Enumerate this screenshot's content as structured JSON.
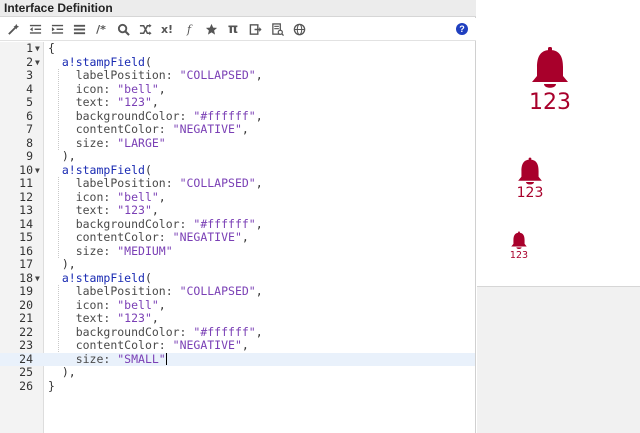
{
  "panel": {
    "title": "Interface Definition"
  },
  "toolbar": {
    "icons": [
      "magic-wand-icon",
      "outdent-icon",
      "indent-icon",
      "list-icon",
      "comment-icon",
      "search-icon",
      "shuffle-icon",
      "expression-icon",
      "star-icon",
      "pi-icon",
      "export-icon",
      "database-icon",
      "globe-icon"
    ],
    "labels": {
      "comment": "/*",
      "expression": "x!",
      "fx": "𝑓",
      "pi": "π"
    },
    "help": "?"
  },
  "code": {
    "line_numbers": [
      "1",
      "2",
      "3",
      "4",
      "5",
      "6",
      "7",
      "8",
      "9",
      "10",
      "11",
      "12",
      "13",
      "14",
      "15",
      "16",
      "17",
      "18",
      "19",
      "20",
      "21",
      "22",
      "23",
      "24",
      "25",
      "26"
    ],
    "stamps": [
      {
        "labelPosition": "\"COLLAPSED\"",
        "icon": "\"bell\"",
        "text": "\"123\"",
        "backgroundColor": "\"#ffffff\"",
        "contentColor": "\"NEGATIVE\"",
        "size": "\"LARGE\""
      },
      {
        "labelPosition": "\"COLLAPSED\"",
        "icon": "\"bell\"",
        "text": "\"123\"",
        "backgroundColor": "\"#ffffff\"",
        "contentColor": "\"NEGATIVE\"",
        "size": "\"MEDIUM\""
      },
      {
        "labelPosition": "\"COLLAPSED\"",
        "icon": "\"bell\"",
        "text": "\"123\"",
        "backgroundColor": "\"#ffffff\"",
        "contentColor": "\"NEGATIVE\"",
        "size": "\"SMALL\""
      }
    ],
    "tokens": {
      "open_brace": "{",
      "close_brace": "}",
      "fn_name": "a!stampField",
      "open_paren": "(",
      "close_paren_comma": "),",
      "k_labelPosition": "labelPosition: ",
      "k_icon": "icon: ",
      "k_text": "text: ",
      "k_backgroundColor": "backgroundColor: ",
      "k_contentColor": "contentColor: ",
      "k_size": "size: ",
      "comma": ","
    }
  },
  "preview": {
    "stamps": [
      {
        "text": "123",
        "size": "LARGE"
      },
      {
        "text": "123",
        "size": "MEDIUM"
      },
      {
        "text": "123",
        "size": "SMALL"
      }
    ],
    "content_color": "#a8002b"
  },
  "colors": {
    "function": "#1a2bb3",
    "string": "#7a3fb5",
    "help": "#1f3fbf"
  }
}
